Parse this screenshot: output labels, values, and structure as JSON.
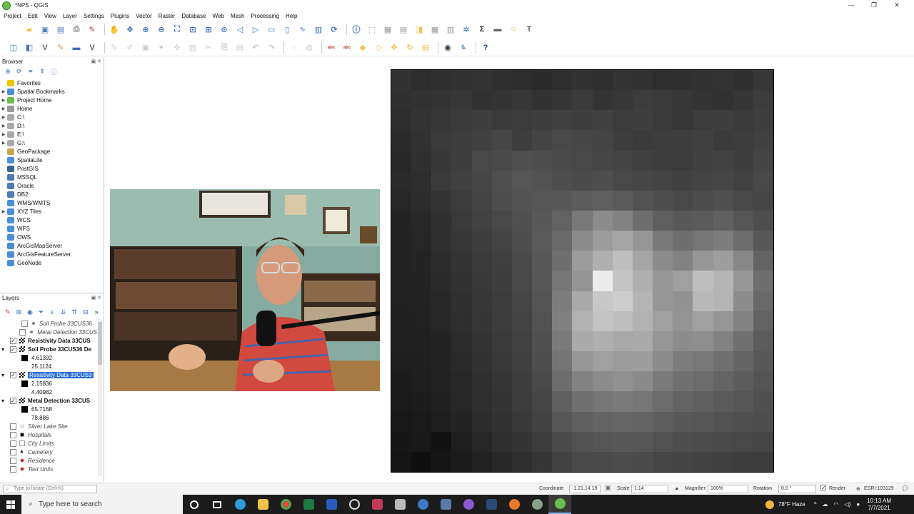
{
  "window": {
    "title": "*NPS - QGIS",
    "minimize": "—",
    "maximize": "❐",
    "close": "✕"
  },
  "menu": [
    "Project",
    "Edit",
    "View",
    "Layer",
    "Settings",
    "Plugins",
    "Vector",
    "Raster",
    "Database",
    "Web",
    "Mesh",
    "Processing",
    "Help"
  ],
  "browser": {
    "title": "Browser",
    "items": [
      {
        "label": "Favorites",
        "icon": "star-icon",
        "arrow": "",
        "color": "#f0c400"
      },
      {
        "label": "Spatial Bookmarks",
        "icon": "bookmark-icon",
        "arrow": "▶",
        "color": "#4a8ed8"
      },
      {
        "label": "Project Home",
        "icon": "folder-icon",
        "arrow": "▶",
        "color": "#6abf4b"
      },
      {
        "label": "Home",
        "icon": "folder-icon",
        "arrow": "▶",
        "color": "#999999"
      },
      {
        "label": "C:\\",
        "icon": "drive-icon",
        "arrow": "▶",
        "color": "#aaaaaa"
      },
      {
        "label": "D:\\",
        "icon": "drive-icon",
        "arrow": "▶",
        "color": "#aaaaaa"
      },
      {
        "label": "E:\\",
        "icon": "drive-icon",
        "arrow": "▶",
        "color": "#aaaaaa"
      },
      {
        "label": "G:\\",
        "icon": "drive-icon",
        "arrow": "▶",
        "color": "#aaaaaa"
      },
      {
        "label": "GeoPackage",
        "icon": "geopackage-icon",
        "arrow": "",
        "color": "#c6a44a"
      },
      {
        "label": "SpatiaLite",
        "icon": "spatialite-icon",
        "arrow": "",
        "color": "#4a8ed8"
      },
      {
        "label": "PostGIS",
        "icon": "postgis-icon",
        "arrow": "",
        "color": "#336791"
      },
      {
        "label": "MSSQL",
        "icon": "mssql-icon",
        "arrow": "",
        "color": "#4a7ab8"
      },
      {
        "label": "Oracle",
        "icon": "oracle-icon",
        "arrow": "",
        "color": "#4a7ab8"
      },
      {
        "label": "DB2",
        "icon": "db2-icon",
        "arrow": "",
        "color": "#4a7ab8"
      },
      {
        "label": "WMS/WMTS",
        "icon": "globe-icon",
        "arrow": "",
        "color": "#4a8ed8"
      },
      {
        "label": "XYZ Tiles",
        "icon": "xyz-tiles-icon",
        "arrow": "▶",
        "color": "#4a8ed8"
      },
      {
        "label": "WCS",
        "icon": "globe-icon",
        "arrow": "",
        "color": "#4a8ed8"
      },
      {
        "label": "WFS",
        "icon": "globe-icon",
        "arrow": "",
        "color": "#4a8ed8"
      },
      {
        "label": "OWS",
        "icon": "globe-icon",
        "arrow": "",
        "color": "#4a8ed8"
      },
      {
        "label": "ArcGisMapServer",
        "icon": "globe-icon",
        "arrow": "",
        "color": "#4a8ed8"
      },
      {
        "label": "ArcGisFeatureServer",
        "icon": "globe-icon",
        "arrow": "",
        "color": "#4a8ed8"
      },
      {
        "label": "GeoNode",
        "icon": "geonode-icon",
        "arrow": "",
        "color": "#4a8ed8"
      }
    ]
  },
  "layers": {
    "title": "Layers",
    "items": [
      {
        "label": "Soil Probe 33CUS36",
        "style": "italic",
        "checked": false,
        "symbol": "dot",
        "indent": 30,
        "expand": ""
      },
      {
        "label": "Metal Detection 33CUS",
        "style": "italic",
        "checked": false,
        "symbol": "dot",
        "indent": 30,
        "expand": ""
      },
      {
        "label": "Resistivity Data 33CUS",
        "style": "bold",
        "checked": true,
        "symbol": "raster",
        "indent": 14,
        "expand": ""
      },
      {
        "label": "Soil Probe 33CUS36 De",
        "style": "bold",
        "checked": true,
        "symbol": "raster",
        "indent": 14,
        "expand": "▾"
      },
      {
        "label": "4.61392",
        "style": "legend-max",
        "swatch": "#000000"
      },
      {
        "label": "25.1124",
        "style": "legend-min"
      },
      {
        "label": "Resistivity Data 33CUS3",
        "style": "selected",
        "checked": true,
        "symbol": "raster",
        "indent": 14,
        "expand": "▾"
      },
      {
        "label": "2.15836",
        "style": "legend-max",
        "swatch": "#000000"
      },
      {
        "label": "4.40982",
        "style": "legend-min"
      },
      {
        "label": "Metal Detection 33CUS",
        "style": "bold",
        "checked": true,
        "symbol": "raster",
        "indent": 14,
        "expand": "▾"
      },
      {
        "label": "65.7168",
        "style": "legend-max",
        "swatch": "#000000"
      },
      {
        "label": "78.886",
        "style": "legend-min"
      },
      {
        "label": "Silver Lake Site",
        "style": "italic",
        "checked": false,
        "symbol": "dot-open",
        "indent": 14,
        "expand": ""
      },
      {
        "label": "Hospitals",
        "style": "italic",
        "checked": false,
        "symbol": "square",
        "indent": 14,
        "expand": ""
      },
      {
        "label": "City Limits",
        "style": "italic",
        "checked": false,
        "symbol": "box",
        "indent": 14,
        "expand": ""
      },
      {
        "label": "Cemetery",
        "style": "italic",
        "checked": false,
        "symbol": "triangle",
        "indent": 14,
        "expand": ""
      },
      {
        "label": "Residence",
        "style": "italic",
        "checked": false,
        "symbol": "dot-red",
        "indent": 14,
        "expand": ""
      },
      {
        "label": "Test Units",
        "style": "italic",
        "checked": false,
        "symbol": "dot-red",
        "indent": 14,
        "expand": ""
      }
    ]
  },
  "raster": {
    "cols": 19,
    "rows": 20,
    "values": [
      [
        50,
        45,
        48,
        50,
        52,
        48,
        45,
        42,
        46,
        50,
        48,
        52,
        50,
        46,
        48,
        50,
        52,
        48,
        55
      ],
      [
        48,
        50,
        52,
        55,
        50,
        52,
        55,
        50,
        54,
        58,
        52,
        55,
        60,
        58,
        55,
        52,
        50,
        54,
        60
      ],
      [
        45,
        52,
        55,
        58,
        62,
        58,
        60,
        62,
        65,
        62,
        65,
        60,
        62,
        58,
        55,
        60,
        62,
        58,
        62
      ],
      [
        42,
        50,
        58,
        60,
        65,
        70,
        62,
        68,
        72,
        70,
        68,
        62,
        58,
        60,
        62,
        65,
        58,
        60,
        65
      ],
      [
        40,
        48,
        55,
        62,
        72,
        75,
        80,
        78,
        75,
        72,
        70,
        68,
        65,
        62,
        60,
        64,
        66,
        62,
        68
      ],
      [
        42,
        45,
        58,
        65,
        70,
        80,
        85,
        82,
        78,
        75,
        78,
        72,
        70,
        68,
        65,
        68,
        70,
        66,
        72
      ],
      [
        38,
        44,
        52,
        60,
        68,
        78,
        82,
        85,
        88,
        92,
        95,
        90,
        82,
        78,
        72,
        76,
        80,
        72,
        70
      ],
      [
        36,
        40,
        48,
        58,
        66,
        72,
        80,
        88,
        98,
        120,
        140,
        130,
        110,
        95,
        88,
        90,
        96,
        85,
        78
      ],
      [
        35,
        38,
        46,
        55,
        62,
        68,
        78,
        90,
        105,
        140,
        155,
        165,
        150,
        120,
        110,
        118,
        125,
        108,
        88
      ],
      [
        34,
        36,
        44,
        52,
        58,
        64,
        74,
        88,
        110,
        155,
        175,
        190,
        165,
        140,
        130,
        150,
        158,
        135,
        100
      ],
      [
        34,
        35,
        42,
        50,
        56,
        62,
        72,
        86,
        118,
        148,
        235,
        195,
        175,
        150,
        160,
        190,
        180,
        150,
        110
      ],
      [
        33,
        34,
        40,
        48,
        55,
        60,
        70,
        84,
        125,
        170,
        200,
        205,
        180,
        150,
        145,
        185,
        180,
        140,
        105
      ],
      [
        32,
        33,
        38,
        46,
        54,
        60,
        68,
        82,
        128,
        178,
        195,
        190,
        178,
        160,
        148,
        160,
        150,
        130,
        98
      ],
      [
        32,
        32,
        36,
        44,
        52,
        58,
        66,
        80,
        122,
        170,
        175,
        168,
        170,
        150,
        140,
        142,
        130,
        112,
        92
      ],
      [
        30,
        31,
        35,
        42,
        50,
        56,
        64,
        78,
        116,
        150,
        160,
        155,
        158,
        140,
        125,
        120,
        112,
        100,
        88
      ],
      [
        28,
        30,
        34,
        40,
        48,
        54,
        62,
        74,
        108,
        130,
        140,
        145,
        138,
        122,
        112,
        108,
        100,
        92,
        84
      ],
      [
        26,
        28,
        32,
        38,
        46,
        52,
        60,
        70,
        96,
        112,
        118,
        122,
        118,
        108,
        100,
        96,
        90,
        86,
        80
      ],
      [
        24,
        26,
        30,
        36,
        44,
        50,
        56,
        66,
        86,
        96,
        100,
        102,
        100,
        94,
        88,
        86,
        82,
        80,
        78
      ],
      [
        22,
        24,
        18,
        30,
        38,
        46,
        52,
        60,
        74,
        82,
        86,
        88,
        86,
        82,
        78,
        76,
        74,
        72,
        70
      ],
      [
        20,
        15,
        22,
        28,
        34,
        40,
        46,
        54,
        66,
        72,
        74,
        76,
        74,
        70,
        68,
        66,
        64,
        62,
        60
      ]
    ]
  },
  "status": {
    "locator_placeholder": "Type to locate (Ctrl+K)",
    "coordinate_label": "Coordinate",
    "coordinate_value": "-1.21,14.19",
    "scale_label": "Scale",
    "scale_value": "1:14",
    "magnifier_label": "Magnifier",
    "magnifier_value": "100%",
    "rotation_label": "Rotation",
    "rotation_value": "0.0 °",
    "render_label": "Render",
    "crs_label": "ESRI:103129"
  },
  "taskbar": {
    "search_placeholder": "Type here to search",
    "weather": "78°F  Haze",
    "time": "10:13 AM",
    "date": "7/7/2021"
  }
}
